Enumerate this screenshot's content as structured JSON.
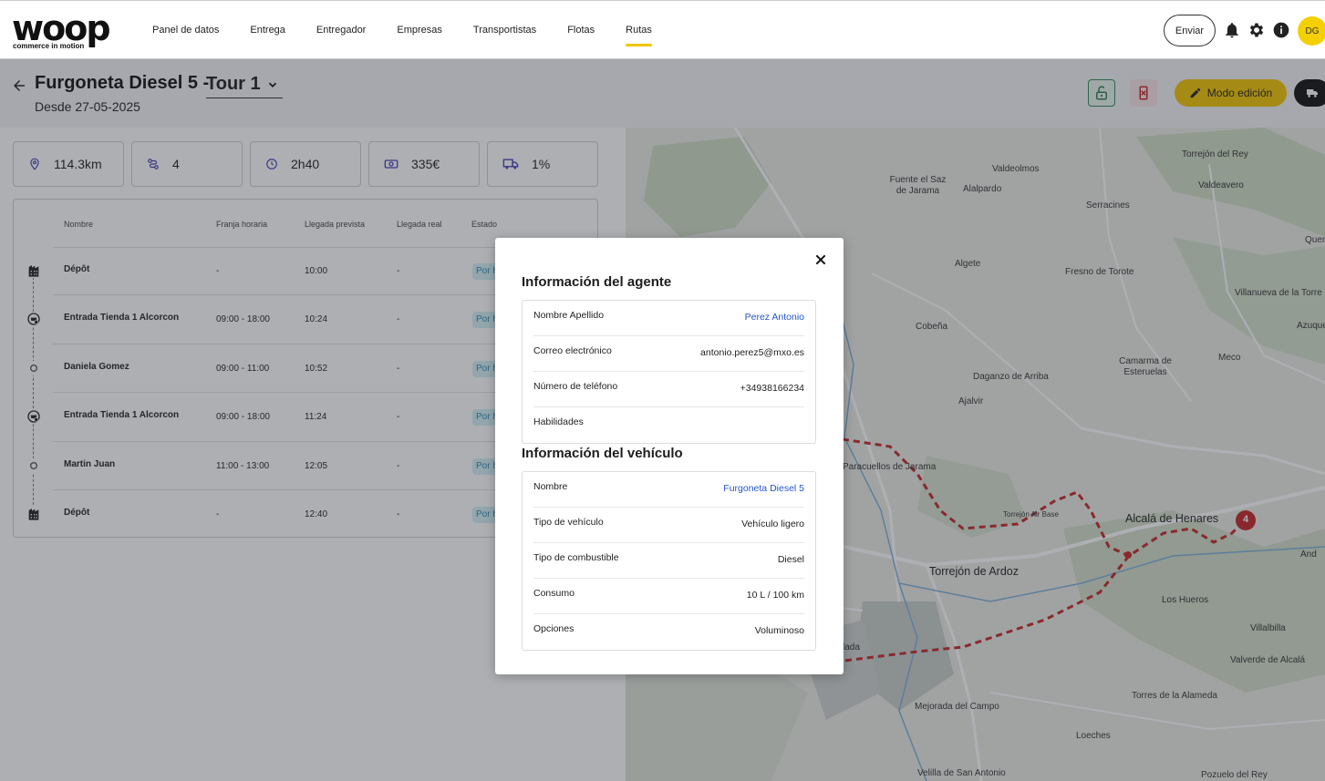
{
  "logo": {
    "word": "woop",
    "tagline": "commerce in motion"
  },
  "nav": {
    "items": [
      {
        "label": "Panel de datos"
      },
      {
        "label": "Entrega"
      },
      {
        "label": "Entregador"
      },
      {
        "label": "Empresas"
      },
      {
        "label": "Transportistas"
      },
      {
        "label": "Flotas"
      },
      {
        "label": "Rutas"
      }
    ],
    "active": "Rutas",
    "send_label": "Enviar",
    "avatar_initials": "DG"
  },
  "header": {
    "title": "Furgoneta Diesel 5 -",
    "tour": "Tour 1",
    "subtitle": "Desde 27-05-2025",
    "edit_label": "Modo edición"
  },
  "stats": [
    {
      "icon": "location-pin-icon",
      "value": "114.3km"
    },
    {
      "icon": "stops-icon",
      "value": "4"
    },
    {
      "icon": "clock-icon",
      "value": "2h40"
    },
    {
      "icon": "money-icon",
      "value": "335€"
    },
    {
      "icon": "truck-load-icon",
      "value": "1%"
    }
  ],
  "table": {
    "headers": [
      "Nombre",
      "Franja horaria",
      "Llegada prevista",
      "Llegada real",
      "Estado"
    ],
    "rows": [
      {
        "name": "Dépôt",
        "window": "-",
        "eta": "10:00",
        "actual": "-",
        "status": "Por h"
      },
      {
        "name": "Entrada Tienda 1 Alcorcon",
        "window": "09:00 - 18:00",
        "eta": "10:24",
        "actual": "-",
        "status": "Por h"
      },
      {
        "name": "Daniela Gomez",
        "window": "09:00 - 11:00",
        "eta": "10:52",
        "actual": "-",
        "status": "Por h"
      },
      {
        "name": "Entrada Tienda 1 Alcorcon",
        "window": "09:00 - 18:00",
        "eta": "11:24",
        "actual": "-",
        "status": "Por h"
      },
      {
        "name": "Martin Juan",
        "window": "11:00 - 13:00",
        "eta": "12:05",
        "actual": "-",
        "status": "Por h"
      },
      {
        "name": "Dépôt",
        "window": "-",
        "eta": "12:40",
        "actual": "-",
        "status": "Por h"
      }
    ]
  },
  "map": {
    "labels": [
      "Torrejón del Rey",
      "Valdeolmos",
      "Fuente el Saz de Jarama",
      "Alalpardo",
      "Valdeavero",
      "Serracines",
      "Quer",
      "Algete",
      "Fresno de Torote",
      "Villanueva de la Torre",
      "Azuque",
      "Cobeña",
      "Camarma de Esteruelas",
      "Meco",
      "Daganzo de Arriba",
      "Ajalvir",
      "Paracuellos de Jarama",
      "Torrejón Air Base",
      "Alcalá de Henares",
      "And",
      "Torrejón de Ardoz",
      "Los Hueros",
      "Villalbilla",
      "lada",
      "Valverde de Alcalá",
      "Torres de la Alameda",
      "Mejorada del Campo",
      "Loeches",
      "Velilla de San Antonio",
      "Pozuelo del Rey"
    ],
    "route_marker": "4",
    "route_color": "#c62828"
  },
  "modal": {
    "agent_title": "Información del agente",
    "agent": [
      {
        "key": "Nombre Apellido",
        "value": "Perez Antonio",
        "link": true
      },
      {
        "key": "Correo electrónico",
        "value": "antonio.perez5@mxo.es",
        "link": false
      },
      {
        "key": "Número de teléfono",
        "value": "+34938166234",
        "link": false
      },
      {
        "key": "Habilidades",
        "value": "",
        "link": false
      }
    ],
    "vehicle_title": "Información del vehículo",
    "vehicle": [
      {
        "key": "Nombre",
        "value": "Furgoneta Diesel 5",
        "link": true
      },
      {
        "key": "Tipo de vehículo",
        "value": "Vehículo ligero",
        "link": false
      },
      {
        "key": "Tipo de combustible",
        "value": "Diesel",
        "link": false
      },
      {
        "key": "Consumo",
        "value": "10 L / 100 km",
        "link": false
      },
      {
        "key": "Opciones",
        "value": "Voluminoso",
        "link": false
      }
    ]
  },
  "colors": {
    "accent": "#f2c500",
    "link": "#2456c7",
    "status_bg": "#d5f0f6"
  }
}
